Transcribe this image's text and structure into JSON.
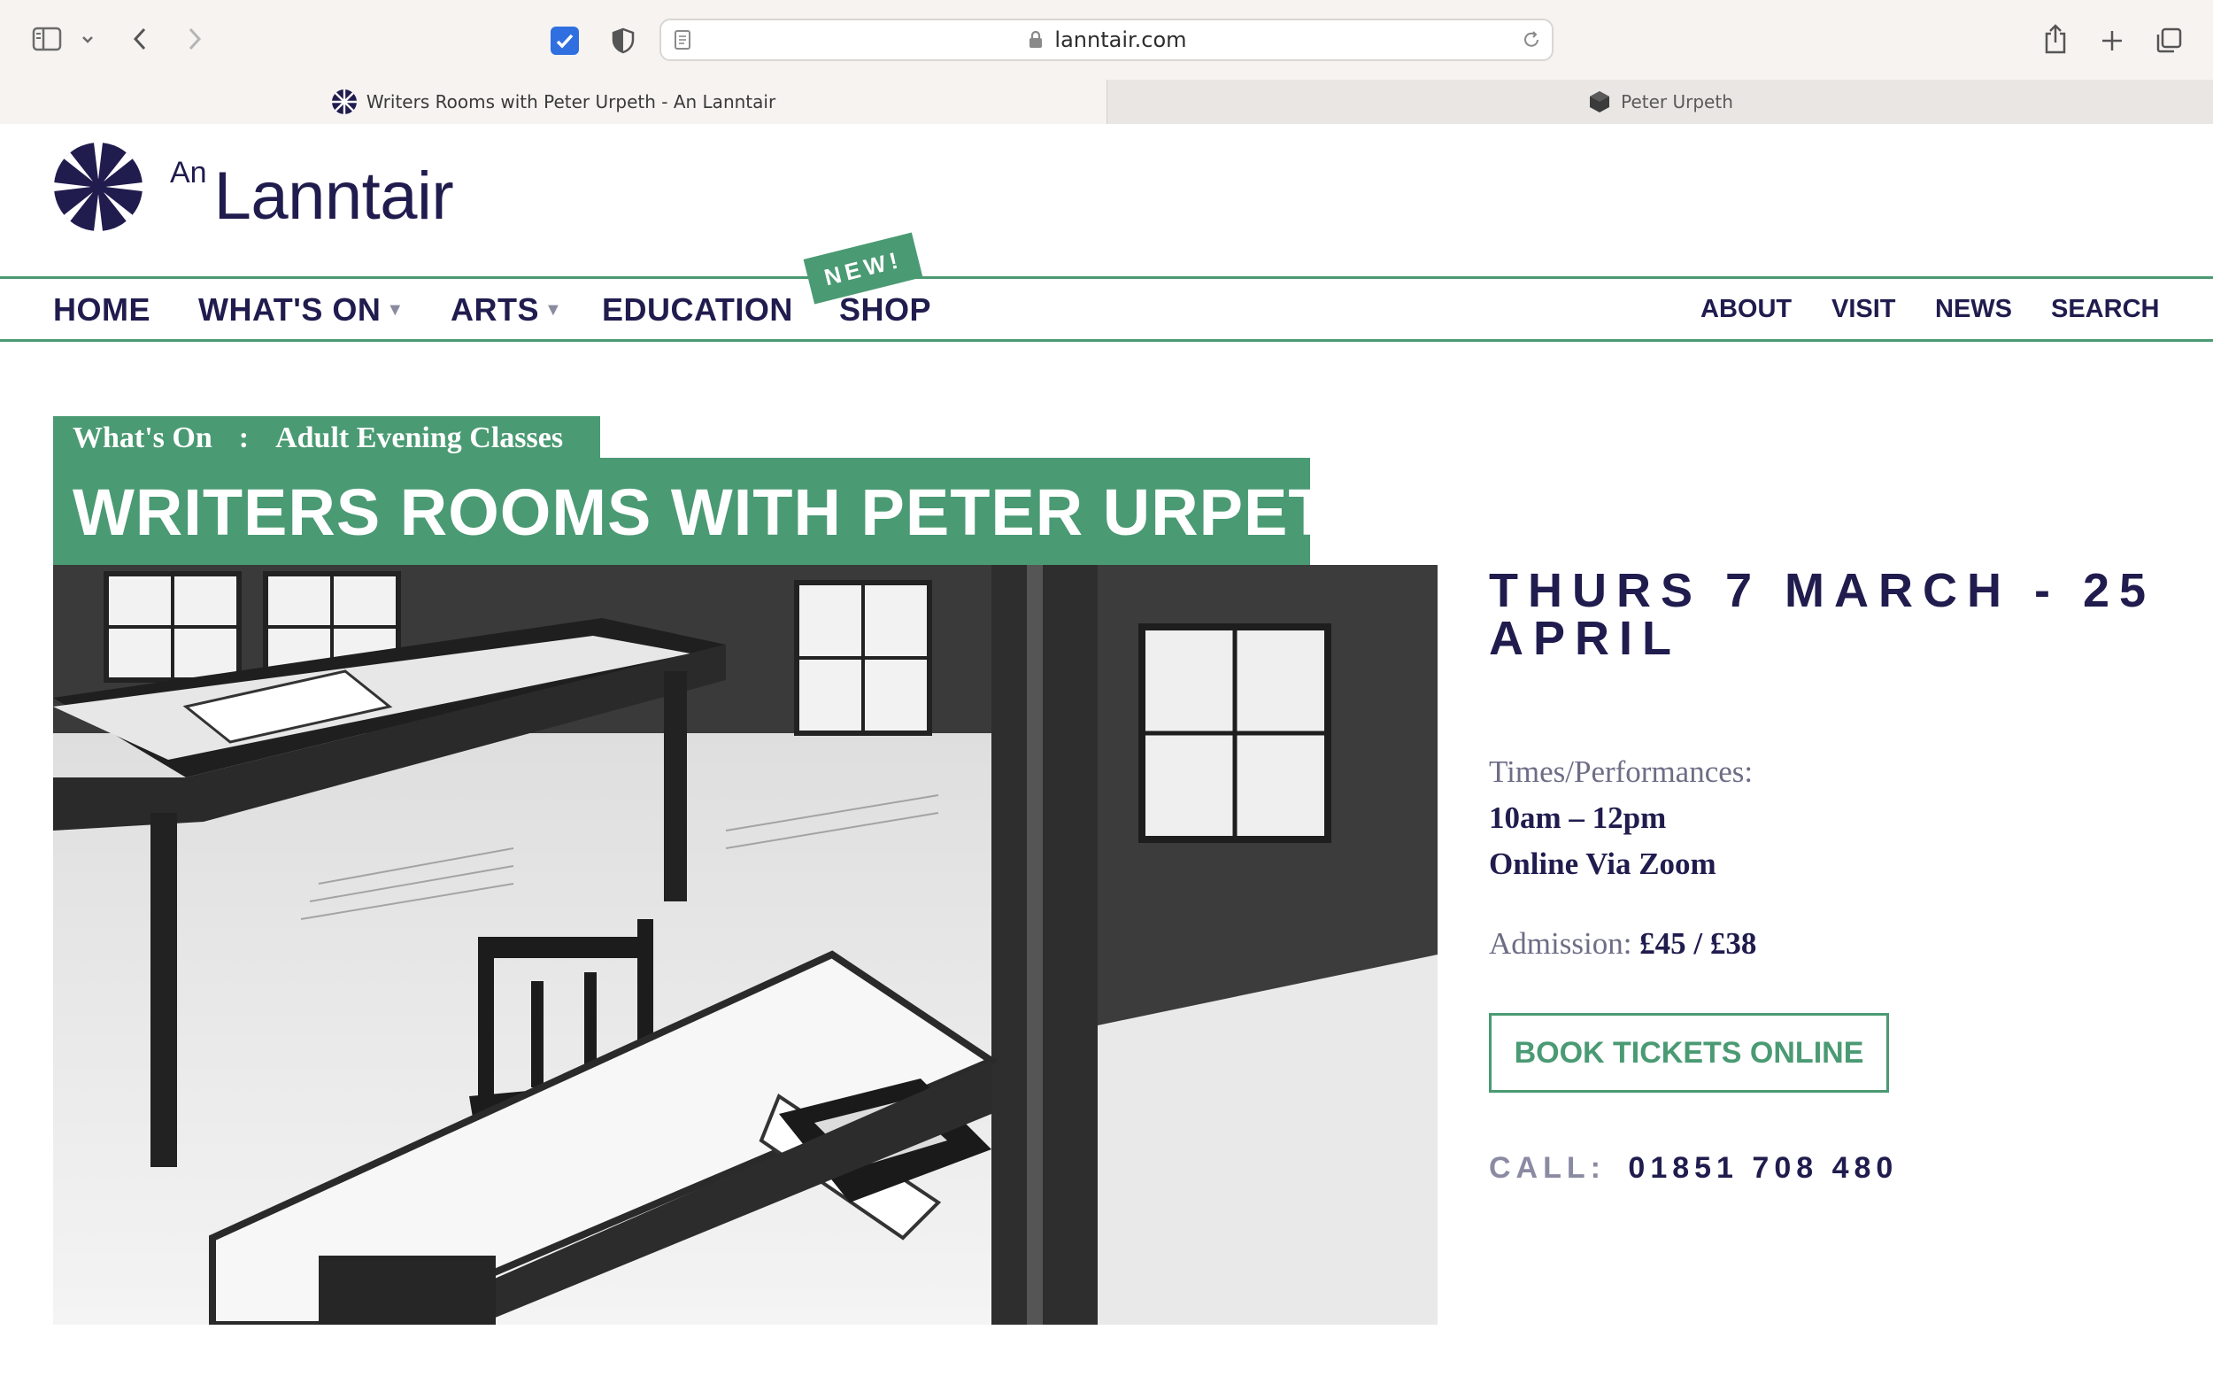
{
  "browser": {
    "url": "lanntair.com",
    "tabs": [
      {
        "title": "Writers Rooms with Peter Urpeth - An Lanntair",
        "active": true
      },
      {
        "title": "Peter Urpeth",
        "active": false
      }
    ]
  },
  "site": {
    "logo": {
      "prefix": "An",
      "name": "Lanntair"
    },
    "nav_left": [
      {
        "label": "HOME",
        "dropdown": false
      },
      {
        "label": "WHAT'S ON",
        "dropdown": true
      },
      {
        "label": "ARTS",
        "dropdown": true
      },
      {
        "label": "EDUCATION",
        "dropdown": false
      },
      {
        "label": "SHOP",
        "dropdown": false
      }
    ],
    "dropdown_caret": "▼",
    "new_badge": "NEW!",
    "nav_right": [
      "ABOUT",
      "VISIT",
      "NEWS",
      "SEARCH"
    ]
  },
  "event": {
    "breadcrumb": {
      "parent": "What's On",
      "separator": ":",
      "current": "Adult Evening Classes"
    },
    "title": "WRITERS ROOMS WITH PETER URPETH",
    "date": "THURS 7 MARCH - 25 APRIL",
    "times_label": "Times/Performances:",
    "times": [
      "10am – 12pm",
      "Online Via Zoom"
    ],
    "admission_label": "Admission:",
    "admission_value": "£45 / £38",
    "book_label": "BOOK TICKETS ONLINE",
    "call_label": "CALL:",
    "call_number": "01851 708 480"
  },
  "colors": {
    "brand_green": "#4a9a73",
    "brand_navy": "#201c4e"
  }
}
